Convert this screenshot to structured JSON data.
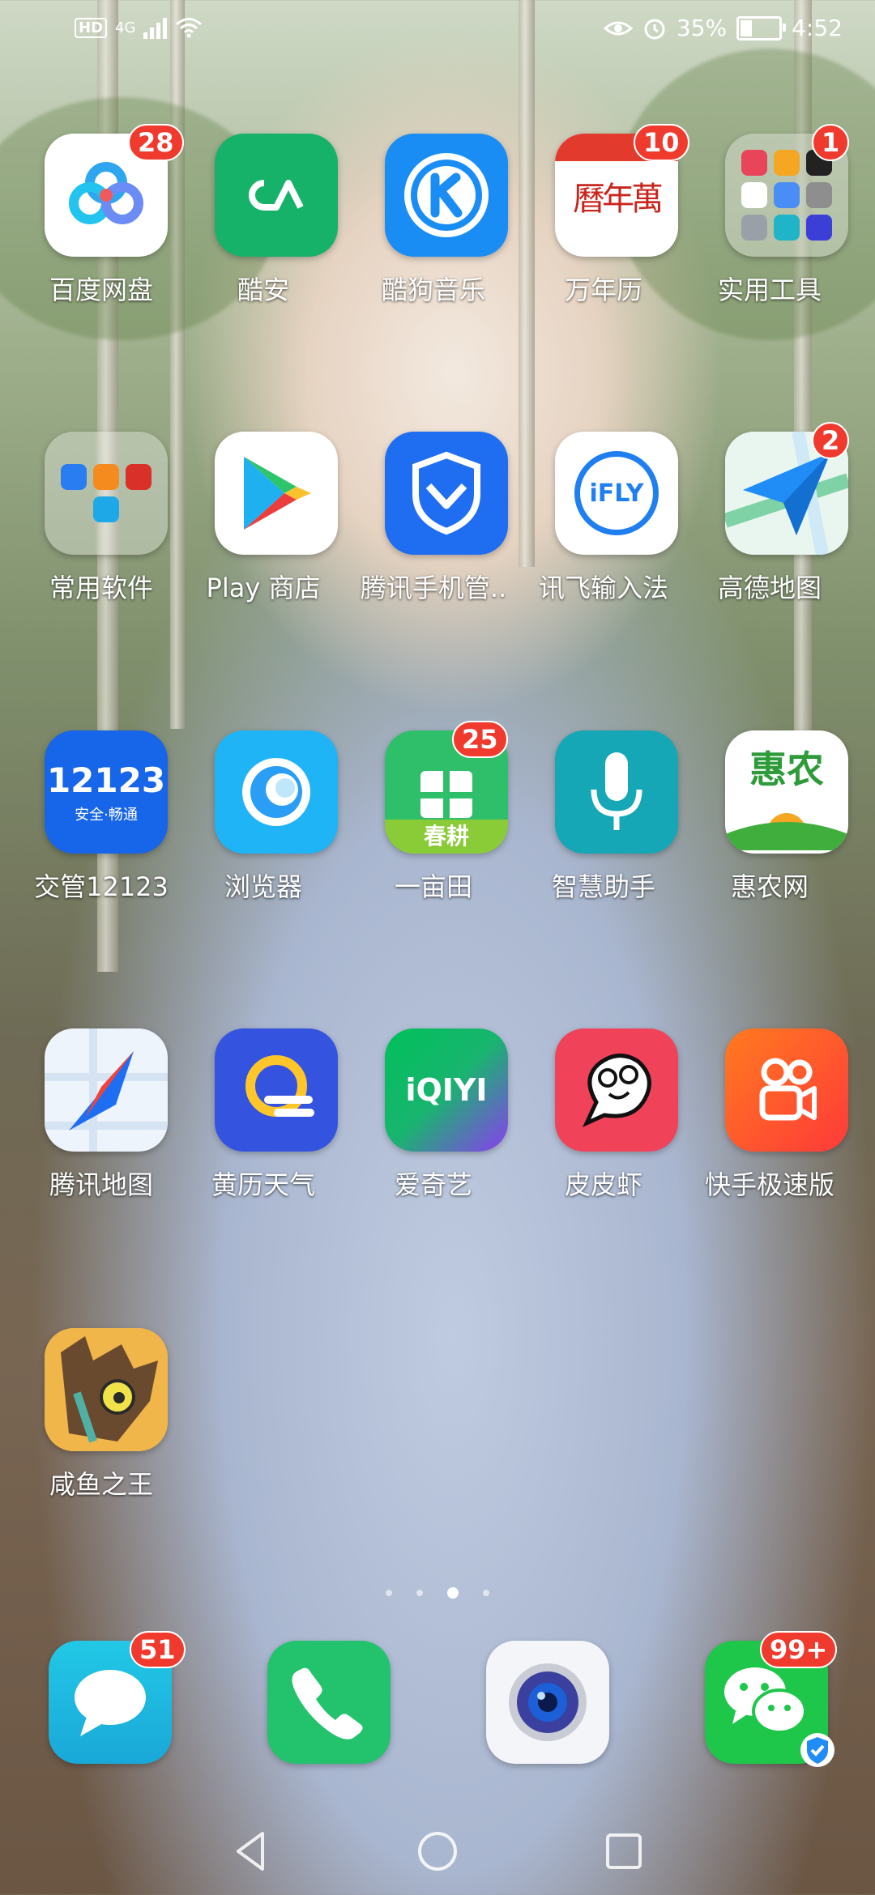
{
  "status_bar": {
    "hd": "HD",
    "network": "4G",
    "battery_percent": "35%",
    "battery_level": 0.35,
    "time": "4:52"
  },
  "apps": [
    {
      "label": "百度网盘",
      "badge": "28",
      "icon": "baidu-netdisk-icon"
    },
    {
      "label": "酷安",
      "badge": "",
      "icon": "coolapk-icon"
    },
    {
      "label": "酷狗音乐",
      "badge": "",
      "icon": "kugou-music-icon"
    },
    {
      "label": "万年历",
      "badge": "10",
      "icon": "calendar-icon",
      "icon_text": "曆年萬"
    },
    {
      "label": "实用工具",
      "badge": "1",
      "icon": "folder-icon"
    },
    {
      "label": "常用软件",
      "badge": "",
      "icon": "folder-icon"
    },
    {
      "label": "Play 商店",
      "badge": "",
      "icon": "play-store-icon"
    },
    {
      "label": "腾讯手机管..",
      "badge": "",
      "icon": "tencent-security-icon"
    },
    {
      "label": "讯飞输入法",
      "badge": "",
      "icon": "ifly-icon",
      "icon_text": "iFLY"
    },
    {
      "label": "高德地图",
      "badge": "2",
      "icon": "amap-icon"
    },
    {
      "label": "交管12123",
      "badge": "",
      "icon": "traffic-12123-icon",
      "icon_text": "12123",
      "icon_sub": "安全·畅通"
    },
    {
      "label": "浏览器",
      "badge": "",
      "icon": "browser-icon"
    },
    {
      "label": "一亩田",
      "badge": "25",
      "icon": "yimutian-icon",
      "icon_text": "春耕"
    },
    {
      "label": "智慧助手",
      "badge": "",
      "icon": "microphone-icon"
    },
    {
      "label": "惠农网",
      "badge": "",
      "icon": "huinong-icon",
      "icon_text": "惠农"
    },
    {
      "label": "腾讯地图",
      "badge": "",
      "icon": "tencent-map-icon"
    },
    {
      "label": "黄历天气",
      "badge": "",
      "icon": "weather-icon"
    },
    {
      "label": "爱奇艺",
      "badge": "",
      "icon": "iqiyi-icon",
      "icon_text": "iQIYI"
    },
    {
      "label": "皮皮虾",
      "badge": "",
      "icon": "pipixia-icon"
    },
    {
      "label": "快手极速版",
      "badge": "",
      "icon": "kuaishou-icon"
    },
    {
      "label": "咸鱼之王",
      "badge": "",
      "icon": "game-icon"
    }
  ],
  "dock": [
    {
      "name": "messages",
      "badge": "51",
      "icon": "message-icon"
    },
    {
      "name": "phone",
      "badge": "",
      "icon": "phone-icon"
    },
    {
      "name": "camera",
      "badge": "",
      "icon": "camera-icon"
    },
    {
      "name": "wechat",
      "badge": "99+",
      "icon": "wechat-icon"
    }
  ],
  "page_indicator": {
    "total": 4,
    "current": 3
  },
  "colors": {
    "badge": "#f03a2e",
    "coolapk": "#17b26a",
    "kugou": "#1a8df5",
    "play": "#ffffff",
    "tencent_security": "#1f6ef2",
    "browser": "#1fb4f5",
    "yimutian": "#2fbf6b",
    "assistant": "#16a7b7",
    "iqiyi": "#00c05a",
    "pipixia": "#f0435a",
    "kuaishou": "#ff5a1f",
    "wechat": "#1ec74a"
  }
}
